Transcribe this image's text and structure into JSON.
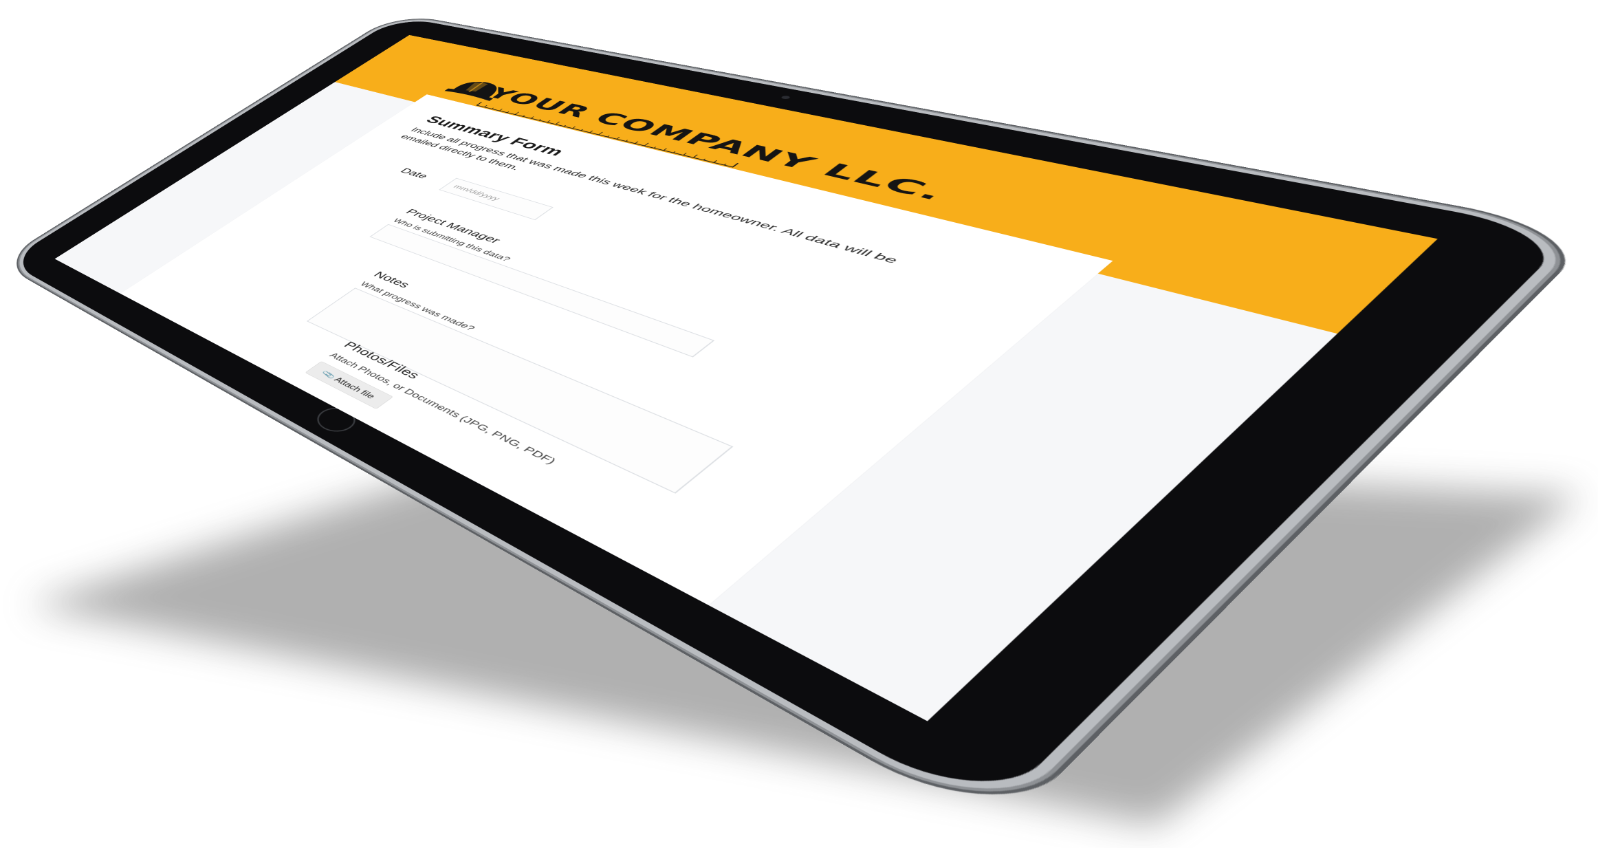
{
  "company": {
    "name": "YOUR COMPANY LLC.",
    "brand_color": "#f8ae1a",
    "logo_icon": "hard-hat-icon"
  },
  "form": {
    "title": "Summary Form",
    "description": "Include all progress that was made this week for the homeowner. All data will be emailed directly to them."
  },
  "fields": {
    "date": {
      "label": "Date",
      "placeholder": "mm/dd/yyyy"
    },
    "project_manager": {
      "label": "Project Manager",
      "help": "Who is submitting this data?"
    },
    "notes": {
      "label": "Notes",
      "help": "What progress was made?"
    },
    "files": {
      "label": "Photos/Files",
      "help": "Attach Photos, or Documents (JPG, PNG, PDF)",
      "button_label": "Attach file",
      "button_icon": "paperclip-icon"
    }
  },
  "device": {
    "type": "tablet",
    "bezel_color": "#0c0c0e",
    "frame_color": "#b9bcc0"
  }
}
